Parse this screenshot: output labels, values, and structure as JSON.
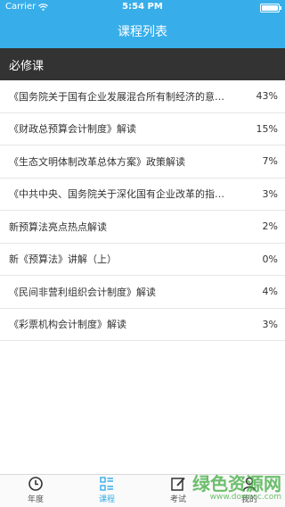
{
  "status_bar": {
    "carrier": "Carrier",
    "time": "5:54 PM",
    "battery_level": 1.0
  },
  "header": {
    "title": "课程列表"
  },
  "section": {
    "title": "必修课"
  },
  "courses": [
    {
      "title": "《国务院关于国有企业发展混合所有制经济的意…",
      "progress": "43%"
    },
    {
      "title": "《财政总预算会计制度》解读",
      "progress": "15%"
    },
    {
      "title": "《生态文明体制改革总体方案》政策解读",
      "progress": "7%"
    },
    {
      "title": "《中共中央、国务院关于深化国有企业改革的指…",
      "progress": "3%"
    },
    {
      "title": "新预算法亮点热点解读",
      "progress": "2%"
    },
    {
      "title": "新《预算法》讲解（上）",
      "progress": "0%"
    },
    {
      "title": "《民间非营利组织会计制度》解读",
      "progress": "4%"
    },
    {
      "title": "《彩票机构会计制度》解读",
      "progress": "3%"
    }
  ],
  "tabs": [
    {
      "label": "年度",
      "icon": "clock-icon"
    },
    {
      "label": "课程",
      "icon": "list-icon",
      "active": true
    },
    {
      "label": "考试",
      "icon": "exam-edit-icon"
    },
    {
      "label": "我的",
      "icon": "user-icon"
    }
  ],
  "watermark": {
    "text": "绿色资源网",
    "url": "www.downcc.com"
  },
  "colors": {
    "primary": "#37aeea",
    "section_bg": "#333333",
    "watermark": "#3caa3c"
  }
}
